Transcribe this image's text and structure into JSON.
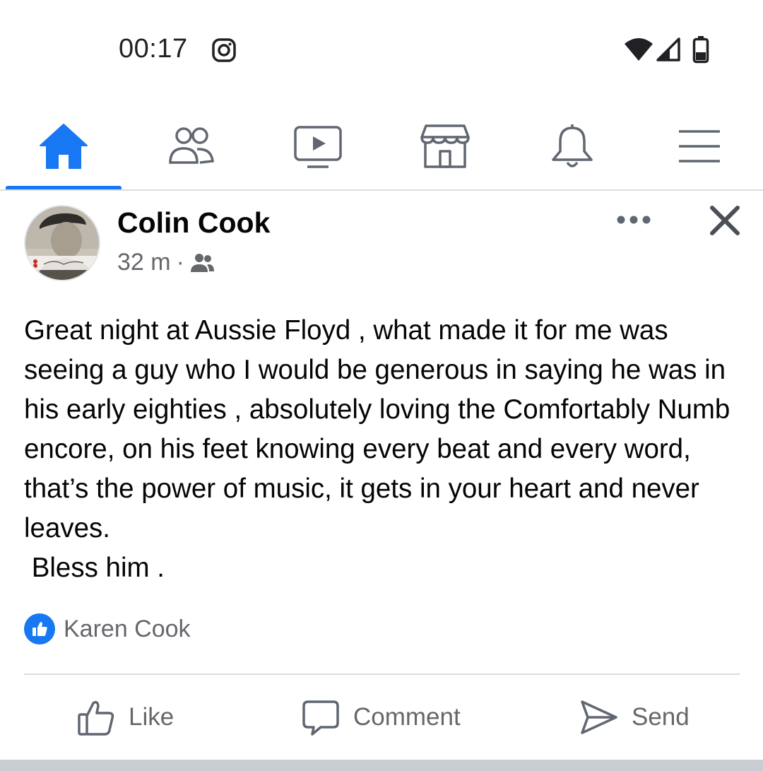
{
  "status_bar": {
    "time": "00:17",
    "icons": [
      "instagram-icon",
      "wifi-icon",
      "signal-icon",
      "battery-icon"
    ]
  },
  "tabs": [
    {
      "name": "home",
      "icon": "home-icon",
      "active": true
    },
    {
      "name": "friends",
      "icon": "friends-icon",
      "active": false
    },
    {
      "name": "watch",
      "icon": "video-icon",
      "active": false
    },
    {
      "name": "marketplace",
      "icon": "store-icon",
      "active": false
    },
    {
      "name": "notifications",
      "icon": "bell-icon",
      "active": false
    },
    {
      "name": "menu",
      "icon": "hamburger-icon",
      "active": false
    }
  ],
  "post": {
    "author": "Colin Cook",
    "time": "32 m",
    "separator": "·",
    "audience_icon": "friends-audience-icon",
    "text": "Great night at Aussie Floyd , what made it for me was seeing a guy who I would be generous in saying he was in his early eighties , absolutely loving the Comfortably Numb encore, on his feet knowing every beat and every word, that’s the power of music, it gets in your heart and never leaves.\n Bless him .",
    "reactions": {
      "icon": "like-reaction-icon",
      "names": "Karen Cook"
    }
  },
  "actions": {
    "like": "Like",
    "comment": "Comment",
    "send": "Send"
  },
  "colors": {
    "accent": "#1877f2",
    "secondary_text": "#65676b",
    "icon_gray": "#606770"
  }
}
